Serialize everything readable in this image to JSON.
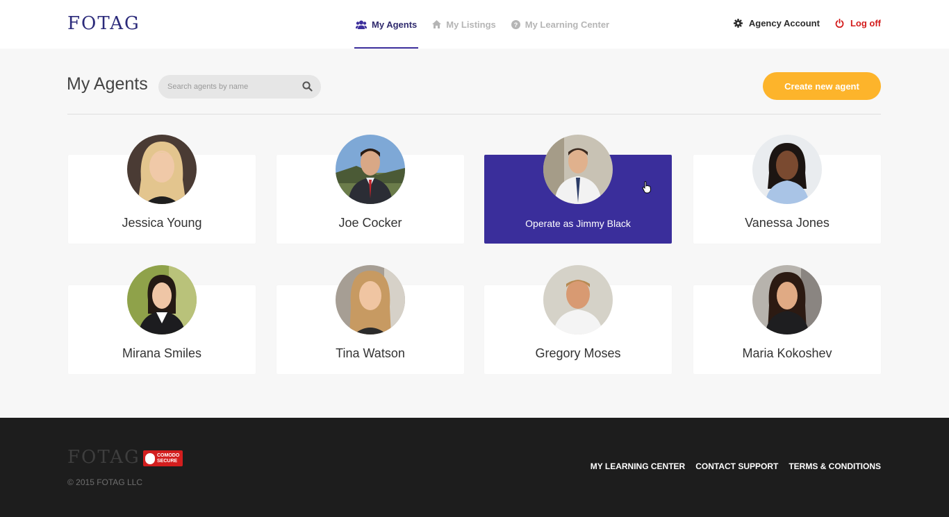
{
  "brand": {
    "logo": "FOTAG"
  },
  "nav": {
    "items": [
      {
        "label": "My Agents",
        "icon": "users-icon",
        "active": true
      },
      {
        "label": "My Listings",
        "icon": "home-icon",
        "active": false
      },
      {
        "label": "My Learning Center",
        "icon": "question-circle-icon",
        "active": false
      }
    ]
  },
  "account": {
    "agency_label": "Agency Account",
    "logoff_label": "Log off"
  },
  "page": {
    "title": "My Agents",
    "search_placeholder": "Search agents by name",
    "create_button": "Create new agent"
  },
  "agents": [
    {
      "name": "Jessica Young"
    },
    {
      "name": "Joe Cocker"
    },
    {
      "name": "Operate as Jimmy Black"
    },
    {
      "name": "Vanessa Jones"
    },
    {
      "name": "Mirana Smiles"
    },
    {
      "name": "Tina Watson"
    },
    {
      "name": "Gregory Moses"
    },
    {
      "name": "Maria Kokoshev"
    }
  ],
  "footer": {
    "logo": "FOTAG",
    "badge_line1": "COMODO",
    "badge_line2": "SECURE",
    "copyright": "© 2015 FOTAG LLC",
    "links": [
      "MY LEARNING CENTER",
      "CONTACT SUPPORT",
      "TERMS & CONDITIONS"
    ]
  },
  "colors": {
    "brand": "#2b2a7a",
    "accent": "#3a2e9b",
    "button": "#fdb42b",
    "logoff": "#d31b1b",
    "footer": "#1d1d1d"
  }
}
